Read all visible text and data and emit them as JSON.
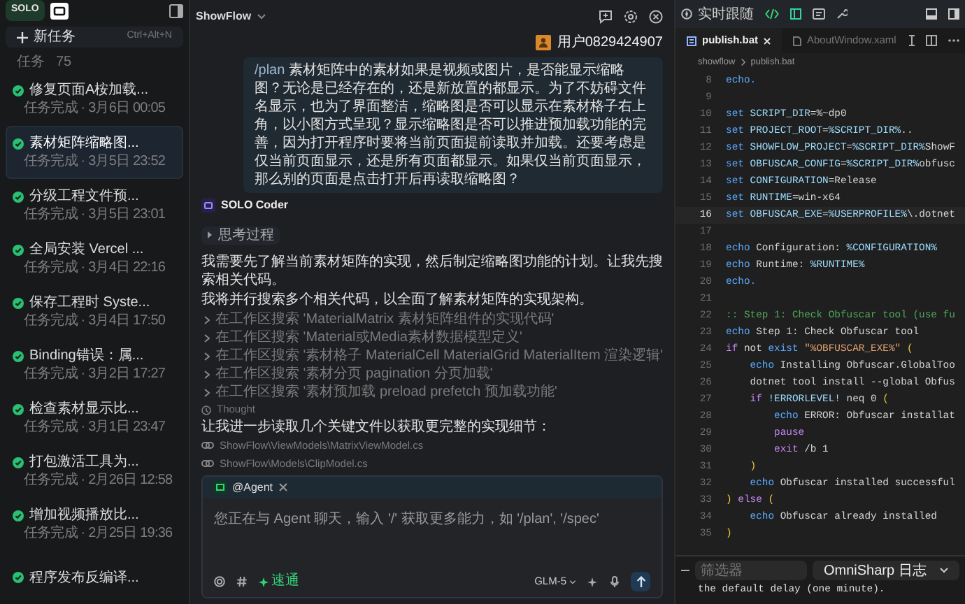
{
  "sidebar": {
    "badge": "SOLO",
    "new_task": {
      "label": "新任务",
      "shortcut": "Ctrl+Alt+N"
    },
    "section": {
      "label": "任务",
      "count": "75"
    },
    "items": [
      {
        "title": "修复页面A桉加载...",
        "subtitle": "任务完成 · 3月6日 00:05",
        "selected": false
      },
      {
        "title": "素材矩阵缩略图...",
        "subtitle": "任务完成 · 3月5日 23:52",
        "selected": true
      },
      {
        "title": "分级工程文件预...",
        "subtitle": "任务完成 · 3月5日 23:01",
        "selected": false
      },
      {
        "title": "全局安装 Vercel ...",
        "subtitle": "任务完成 · 3月4日 22:16",
        "selected": false
      },
      {
        "title": "保存工程时 Syste...",
        "subtitle": "任务完成 · 3月4日 17:50",
        "selected": false
      },
      {
        "title": "Binding错误：属...",
        "subtitle": "任务完成 · 3月2日 17:27",
        "selected": false
      },
      {
        "title": "检查素材显示比...",
        "subtitle": "任务完成 · 3月1日 23:47",
        "selected": false
      },
      {
        "title": "打包激活工具为...",
        "subtitle": "任务完成 · 2月26日 12:58",
        "selected": false
      },
      {
        "title": "增加视频播放比...",
        "subtitle": "任务完成 · 2月25日 19:36",
        "selected": false
      },
      {
        "title": "程序发布反编译...",
        "selected": false
      }
    ]
  },
  "chat": {
    "project": "ShowFlow",
    "user": "用户0829424907",
    "message": {
      "command": "/plan",
      "text": "素材矩阵中的素材如果是视频或图片，是否能显示缩略图？无论是已经存在的，还是新放置的都显示。为了不妨碍文件名显示，也为了界面整洁，缩略图是否可以显示在素材格子右上角，以小图方式呈现？显示缩略图是否可以推进预加载功能的完善，因为打开程序时要将当前页面提前读取并加载。还要考虑是仅当前页面显示，还是所有页面都显示。如果仅当前页面显示，那么别的页面是点击打开后再读取缩略图？"
    },
    "agent": "SOLO Coder",
    "thinking": "思考过程",
    "paragraphs": [
      "我需要先了解当前素材矩阵的实现，然后制定缩略图功能的计划。让我先搜索相关代码。",
      "我将并行搜索多个相关代码，以全面了解素材矩阵的实现架构。"
    ],
    "searches": [
      "在工作区搜索 'MaterialMatrix 素材矩阵组件的实现代码'",
      "在工作区搜索 'Material或Media素材数据模型定义'",
      "在工作区搜索 '素材格子 MaterialCell MaterialGrid MaterialItem 渲染逻辑'",
      "在工作区搜索 '素材分页 pagination 分页加载'",
      "在工作区搜索 '素材预加载 preload prefetch 预加载功能'"
    ],
    "thought": "Thought",
    "followup": "让我进一步读取几个关键文件以获取更完整的实现细节：",
    "files": [
      "ShowFlow\\ViewModels\\MatrixViewModel.cs",
      "ShowFlow\\Models\\ClipModel.cs"
    ],
    "composer": {
      "mode": "@Agent",
      "placeholder": "您正在与 Agent 聊天，输入 '/' 获取更多能力，如 '/plan', '/spec'",
      "speed": "速通",
      "model": "GLM-5"
    }
  },
  "editor": {
    "follow": "实时跟随",
    "tabs": [
      {
        "label": "publish.bat",
        "selected": true
      },
      {
        "label": "AboutWindow.xaml",
        "selected": false
      }
    ],
    "breadcrumb": [
      "showflow",
      "publish.bat"
    ],
    "lines": [
      {
        "number": "8",
        "current": false,
        "tokens": [
          {
            "kind": "kw",
            "text": "echo."
          }
        ]
      },
      {
        "number": "9",
        "current": false
      },
      {
        "number": "10",
        "current": false,
        "tokens": [
          {
            "kind": "kw",
            "text": "set "
          },
          {
            "kind": "var",
            "text": "SCRIPT_DIR"
          },
          {
            "kind": "text",
            "text": "=%~dp0"
          }
        ]
      },
      {
        "number": "11",
        "current": false,
        "tokens": [
          {
            "kind": "kw",
            "text": "set "
          },
          {
            "kind": "var",
            "text": "PROJECT_ROOT"
          },
          {
            "kind": "text",
            "text": "="
          },
          {
            "kind": "var",
            "text": "%SCRIPT_DIR%"
          },
          {
            "kind": "text",
            "text": ".."
          }
        ]
      },
      {
        "number": "12",
        "current": false,
        "tokens": [
          {
            "kind": "kw",
            "text": "set "
          },
          {
            "kind": "var",
            "text": "SHOWFLOW_PROJECT"
          },
          {
            "kind": "text",
            "text": "="
          },
          {
            "kind": "var",
            "text": "%SCRIPT_DIR%"
          },
          {
            "kind": "text",
            "text": "ShowF"
          }
        ]
      },
      {
        "number": "13",
        "current": false,
        "tokens": [
          {
            "kind": "kw",
            "text": "set "
          },
          {
            "kind": "var",
            "text": "OBFUSCAR_CONFIG"
          },
          {
            "kind": "text",
            "text": "="
          },
          {
            "kind": "var",
            "text": "%SCRIPT_DIR%"
          },
          {
            "kind": "text",
            "text": "obfusc"
          }
        ]
      },
      {
        "number": "14",
        "current": false,
        "tokens": [
          {
            "kind": "kw",
            "text": "set "
          },
          {
            "kind": "var",
            "text": "CONFIGURATION"
          },
          {
            "kind": "text",
            "text": "=Release"
          }
        ]
      },
      {
        "number": "15",
        "current": false,
        "tokens": [
          {
            "kind": "kw",
            "text": "set "
          },
          {
            "kind": "var",
            "text": "RUNTIME"
          },
          {
            "kind": "text",
            "text": "=win-x64"
          }
        ]
      },
      {
        "number": "16",
        "current": true,
        "tokens": [
          {
            "kind": "kw",
            "text": "set "
          },
          {
            "kind": "var",
            "text": "OBFUSCAR_EXE"
          },
          {
            "kind": "text",
            "text": "="
          },
          {
            "kind": "var",
            "text": "%USERPROFILE%"
          },
          {
            "kind": "text",
            "text": "\\.dotnet"
          }
        ]
      },
      {
        "number": "17",
        "current": false
      },
      {
        "number": "18",
        "current": false,
        "tokens": [
          {
            "kind": "kw",
            "text": "echo "
          },
          {
            "kind": "text",
            "text": "Configuration: "
          },
          {
            "kind": "var",
            "text": "%CONFIGURATION%"
          }
        ]
      },
      {
        "number": "19",
        "current": false,
        "tokens": [
          {
            "kind": "kw",
            "text": "echo "
          },
          {
            "kind": "text",
            "text": "Runtime: "
          },
          {
            "kind": "var",
            "text": "%RUNTIME%"
          }
        ]
      },
      {
        "number": "20",
        "current": false,
        "tokens": [
          {
            "kind": "kw",
            "text": "echo."
          }
        ]
      },
      {
        "number": "21",
        "current": false
      },
      {
        "number": "22",
        "current": false,
        "tokens": [
          {
            "kind": "comment",
            "text": ":: Step 1: Check Obfuscar tool (use fu"
          }
        ]
      },
      {
        "number": "23",
        "current": false,
        "tokens": [
          {
            "kind": "kw",
            "text": "echo "
          },
          {
            "kind": "text",
            "text": "Step 1: Check Obfuscar tool"
          }
        ]
      },
      {
        "number": "24",
        "current": false,
        "tokens": [
          {
            "kind": "ctrl",
            "text": "if "
          },
          {
            "kind": "text",
            "text": "not "
          },
          {
            "kind": "kw",
            "text": "exist "
          },
          {
            "kind": "str",
            "text": "\"%OBFUSCAR_EXE%\""
          },
          {
            "kind": "paren",
            "text": " ("
          }
        ]
      },
      {
        "number": "25",
        "current": false,
        "tokens": [
          {
            "kind": "kw",
            "text": "    echo "
          },
          {
            "kind": "text",
            "text": "Installing Obfuscar.GlobalToo"
          }
        ]
      },
      {
        "number": "26",
        "current": false,
        "tokens": [
          {
            "kind": "text",
            "text": "    dotnet tool install --global Obfus"
          }
        ]
      },
      {
        "number": "27",
        "current": false,
        "tokens": [
          {
            "kind": "ctrl",
            "text": "    if "
          },
          {
            "kind": "var",
            "text": "!ERRORLEVEL!"
          },
          {
            "kind": "text",
            "text": " neq 0 "
          },
          {
            "kind": "paren",
            "text": "("
          }
        ]
      },
      {
        "number": "28",
        "current": false,
        "tokens": [
          {
            "kind": "kw",
            "text": "        echo "
          },
          {
            "kind": "text",
            "text": "ERROR: Obfuscar installat"
          }
        ]
      },
      {
        "number": "29",
        "current": false,
        "tokens": [
          {
            "kind": "ctrl",
            "text": "        pause"
          }
        ]
      },
      {
        "number": "30",
        "current": false,
        "tokens": [
          {
            "kind": "ctrl",
            "text": "        exit "
          },
          {
            "kind": "text",
            "text": "/b 1"
          }
        ]
      },
      {
        "number": "31",
        "current": false,
        "tokens": [
          {
            "kind": "paren",
            "text": "    )"
          }
        ]
      },
      {
        "number": "32",
        "current": false,
        "tokens": [
          {
            "kind": "kw",
            "text": "    echo "
          },
          {
            "kind": "text",
            "text": "Obfuscar installed successful"
          }
        ]
      },
      {
        "number": "33",
        "current": false,
        "tokens": [
          {
            "kind": "paren",
            "text": ") "
          },
          {
            "kind": "ctrl",
            "text": "else "
          },
          {
            "kind": "paren",
            "text": "("
          }
        ]
      },
      {
        "number": "34",
        "current": false,
        "tokens": [
          {
            "kind": "kw",
            "text": "    echo "
          },
          {
            "kind": "text",
            "text": "Obfuscar already installed"
          }
        ]
      },
      {
        "number": "35",
        "current": false,
        "tokens": [
          {
            "kind": "paren",
            "text": ")"
          }
        ]
      }
    ],
    "output": {
      "filter_placeholder": "筛选器",
      "channel": "OmniSharp 日志",
      "text": "the default delay (one minute)."
    }
  }
}
